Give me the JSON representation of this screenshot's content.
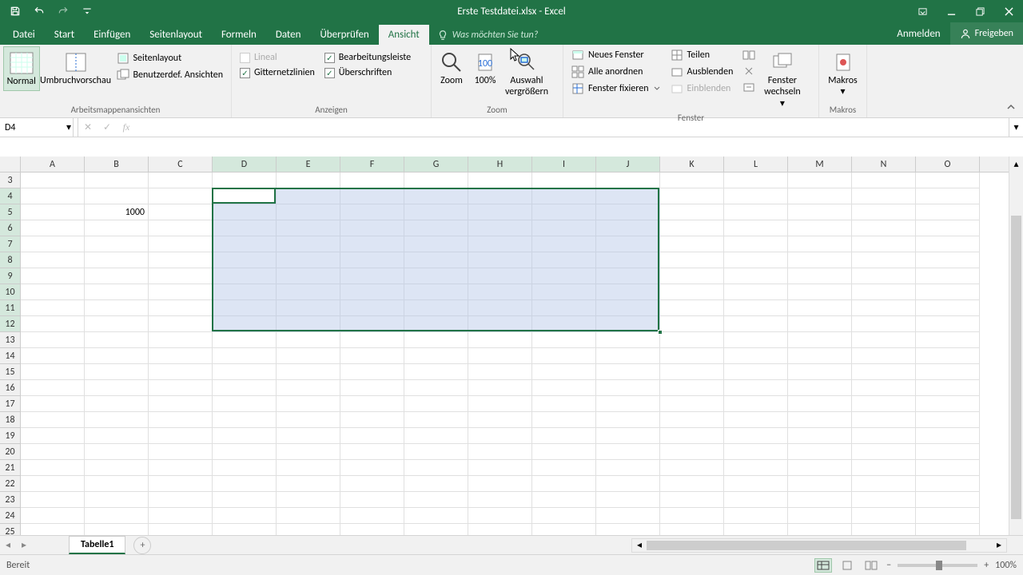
{
  "title": "Erste Testdatei.xlsx - Excel",
  "qat": {
    "undo_tip": "Undo",
    "redo_tip": "Redo"
  },
  "tabs": {
    "datei": "Datei",
    "start": "Start",
    "einfuegen": "Einfügen",
    "seitenlayout": "Seitenlayout",
    "formeln": "Formeln",
    "daten": "Daten",
    "ueberpruefen": "Überprüfen",
    "ansicht": "Ansicht"
  },
  "tell_me": "Was möchten Sie tun?",
  "anmelden": "Anmelden",
  "freigeben": "Freigeben",
  "ribbon": {
    "views": {
      "normal": "Normal",
      "umbruch": "Umbruchvorschau",
      "seitenlayout": "Seitenlayout",
      "benutzerdef": "Benutzerdef. Ansichten",
      "group": "Arbeitsmappenansichten"
    },
    "show": {
      "lineal": "Lineal",
      "bearbeitungsleiste": "Bearbeitungsleiste",
      "gitternetzlinien": "Gitternetzlinien",
      "ueberschriften": "Überschriften",
      "group": "Anzeigen"
    },
    "zoom": {
      "zoom": "Zoom",
      "hundert": "100%",
      "auswahl_l1": "Auswahl",
      "auswahl_l2": "vergrößern",
      "group": "Zoom"
    },
    "window": {
      "neues": "Neues Fenster",
      "alle": "Alle anordnen",
      "fixieren": "Fenster fixieren",
      "teilen": "Teilen",
      "ausblenden": "Ausblenden",
      "einblenden": "Einblenden",
      "wechseln_l1": "Fenster",
      "wechseln_l2": "wechseln",
      "group": "Fenster"
    },
    "makros": {
      "label": "Makros",
      "group": "Makros"
    }
  },
  "namebox": "D4",
  "columns": [
    "A",
    "B",
    "C",
    "D",
    "E",
    "F",
    "G",
    "H",
    "I",
    "J",
    "K",
    "L",
    "M",
    "N",
    "O"
  ],
  "rows_start": 3,
  "rows_end": 25,
  "cell_data": {
    "B5": "1000"
  },
  "selection": {
    "startCol": "D",
    "endCol": "J",
    "startRow": 4,
    "endRow": 12,
    "activeCell": "D4"
  },
  "sheet_tab": "Tabelle1",
  "status": "Bereit",
  "zoom": "100%",
  "chart_data": null
}
